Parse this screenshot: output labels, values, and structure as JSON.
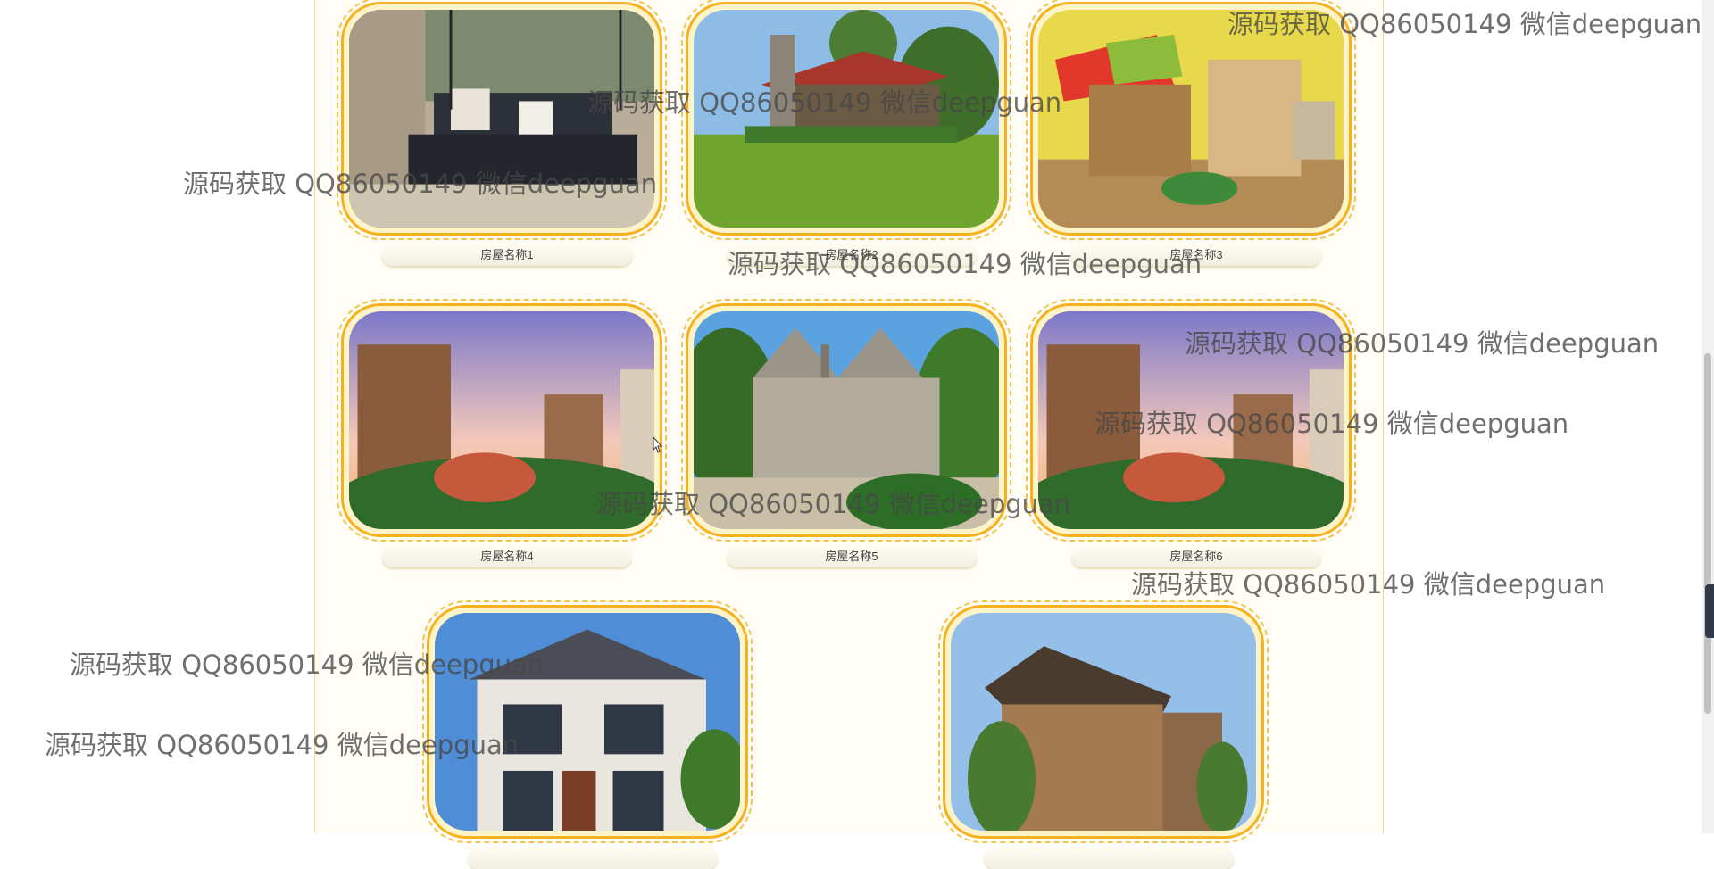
{
  "houses": [
    {
      "name": "房屋名称1",
      "scene": "porch-swing"
    },
    {
      "name": "房屋名称2",
      "scene": "cabin"
    },
    {
      "name": "房屋名称3",
      "scene": "kids-room"
    },
    {
      "name": "房屋名称4",
      "scene": "apartment-tower"
    },
    {
      "name": "房屋名称5",
      "scene": "stone-manor"
    },
    {
      "name": "房屋名称6",
      "scene": "apartment-tower"
    },
    {
      "name": "",
      "scene": "modern-villa"
    },
    {
      "name": "",
      "scene": "wood-house"
    }
  ],
  "watermark_text": "源码获取 QQ86050149 微信deepguan",
  "colors": {
    "frame_border": "#f6b21e",
    "panel_border": "#f3d98a",
    "watermark": "#464646"
  }
}
